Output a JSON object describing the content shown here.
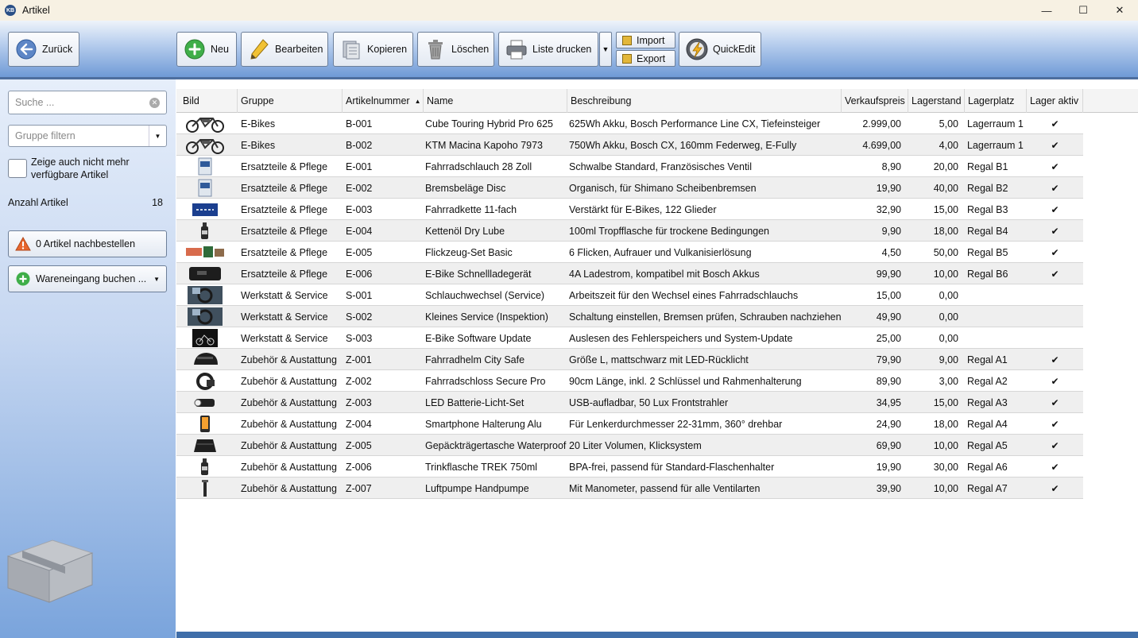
{
  "window": {
    "title": "Artikel",
    "app_icon": "KB",
    "controls": [
      "—",
      "☐",
      "✕"
    ]
  },
  "toolbar": {
    "back_label": "Zurück",
    "new_label": "Neu",
    "edit_label": "Bearbeiten",
    "copy_label": "Kopieren",
    "delete_label": "Löschen",
    "print_label": "Liste drucken",
    "import_label": "Import",
    "export_label": "Export",
    "quickedit_label": "QuickEdit"
  },
  "sidebar": {
    "search_placeholder": "Suche ...",
    "group_filter_placeholder": "Gruppe filtern",
    "show_unavailable_label": "Zeige auch nicht mehr verfügbare Artikel",
    "count_label": "Anzahl Artikel",
    "count_value": "18",
    "reorder_label": "0 Artikel nachbestellen",
    "goods_in_label": "Wareneingang buchen ..."
  },
  "table": {
    "columns": [
      "Bild",
      "Gruppe",
      "Artikelnummer",
      "Name",
      "Beschreibung",
      "Verkaufspreis",
      "Lagerstand",
      "Lagerplatz",
      "Lager aktiv"
    ],
    "sorted_column": "Artikelnummer",
    "rows": [
      {
        "img": "ebike",
        "group": "E-Bikes",
        "nr": "B-001",
        "name": "Cube Touring Hybrid Pro 625",
        "desc": "625Wh Akku, Bosch Performance Line CX, Tiefeinsteiger",
        "price": "2.999,00",
        "stock": "5,00",
        "place": "Lagerraum 1",
        "active": "✔"
      },
      {
        "img": "ebike",
        "group": "E-Bikes",
        "nr": "B-002",
        "name": "KTM Macina Kapoho 7973",
        "desc": "750Wh Akku, Bosch CX, 160mm Federweg, E-Fully",
        "price": "4.699,00",
        "stock": "4,00",
        "place": "Lagerraum 1",
        "active": "✔"
      },
      {
        "img": "box",
        "group": "Ersatzteile & Pflege",
        "nr": "E-001",
        "name": "Fahrradschlauch 28 Zoll",
        "desc": "Schwalbe Standard, Französisches Ventil",
        "price": "8,90",
        "stock": "20,00",
        "place": "Regal B1",
        "active": "✔"
      },
      {
        "img": "box",
        "group": "Ersatzteile & Pflege",
        "nr": "E-002",
        "name": "Bremsbeläge Disc",
        "desc": "Organisch, für Shimano Scheibenbremsen",
        "price": "19,90",
        "stock": "40,00",
        "place": "Regal B2",
        "active": "✔"
      },
      {
        "img": "chain",
        "group": "Ersatzteile & Pflege",
        "nr": "E-003",
        "name": "Fahrradkette 11-fach",
        "desc": "Verstärkt für E-Bikes, 122 Glieder",
        "price": "32,90",
        "stock": "15,00",
        "place": "Regal B3",
        "active": "✔"
      },
      {
        "img": "bottle",
        "group": "Ersatzteile & Pflege",
        "nr": "E-004",
        "name": "Kettenöl Dry Lube",
        "desc": "100ml Tropfflasche für trockene Bedingungen",
        "price": "9,90",
        "stock": "18,00",
        "place": "Regal B4",
        "active": "✔"
      },
      {
        "img": "kit",
        "group": "Ersatzteile & Pflege",
        "nr": "E-005",
        "name": "Flickzeug-Set Basic",
        "desc": "6 Flicken, Aufrauer und Vulkanisierlösung",
        "price": "4,50",
        "stock": "50,00",
        "place": "Regal B5",
        "active": "✔"
      },
      {
        "img": "charger",
        "group": "Ersatzteile & Pflege",
        "nr": "E-006",
        "name": "E-Bike Schnellladegerät",
        "desc": "4A Ladestrom, kompatibel mit Bosch Akkus",
        "price": "99,90",
        "stock": "10,00",
        "place": "Regal B6",
        "active": "✔"
      },
      {
        "img": "photo",
        "group": "Werkstatt & Service",
        "nr": "S-001",
        "name": "Schlauchwechsel (Service)",
        "desc": "Arbeitszeit für den Wechsel eines Fahrradschlauchs",
        "price": "15,00",
        "stock": "0,00",
        "place": "",
        "active": ""
      },
      {
        "img": "photo",
        "group": "Werkstatt & Service",
        "nr": "S-002",
        "name": "Kleines Service (Inspektion)",
        "desc": "Schaltung einstellen, Bremsen prüfen, Schrauben nachziehen",
        "price": "49,90",
        "stock": "0,00",
        "place": "",
        "active": ""
      },
      {
        "img": "dark",
        "group": "Werkstatt & Service",
        "nr": "S-003",
        "name": "E-Bike Software Update",
        "desc": "Auslesen des Fehlerspeichers und System-Update",
        "price": "25,00",
        "stock": "0,00",
        "place": "",
        "active": ""
      },
      {
        "img": "helmet",
        "group": "Zubehör & Austattung",
        "nr": "Z-001",
        "name": "Fahrradhelm City Safe",
        "desc": "Größe L, mattschwarz mit LED-Rücklicht",
        "price": "79,90",
        "stock": "9,00",
        "place": "Regal A1",
        "active": "✔"
      },
      {
        "img": "lock",
        "group": "Zubehör & Austattung",
        "nr": "Z-002",
        "name": "Fahrradschloss Secure Pro",
        "desc": "90cm Länge, inkl. 2 Schlüssel und Rahmenhalterung",
        "price": "89,90",
        "stock": "3,00",
        "place": "Regal A2",
        "active": "✔"
      },
      {
        "img": "light",
        "group": "Zubehör & Austattung",
        "nr": "Z-003",
        "name": "LED Batterie-Licht-Set",
        "desc": "USB-aufladbar, 50 Lux Frontstrahler",
        "price": "34,95",
        "stock": "15,00",
        "place": "Regal A3",
        "active": "✔"
      },
      {
        "img": "phone",
        "group": "Zubehör & Austattung",
        "nr": "Z-004",
        "name": "Smartphone Halterung Alu",
        "desc": "Für Lenkerdurchmesser 22-31mm, 360° drehbar",
        "price": "24,90",
        "stock": "18,00",
        "place": "Regal A4",
        "active": "✔"
      },
      {
        "img": "bag",
        "group": "Zubehör & Austattung",
        "nr": "Z-005",
        "name": "Gepäckträgertasche Waterproof",
        "desc": "20 Liter Volumen, Klicksystem",
        "price": "69,90",
        "stock": "10,00",
        "place": "Regal A5",
        "active": "✔"
      },
      {
        "img": "bottle",
        "group": "Zubehör & Austattung",
        "nr": "Z-006",
        "name": "Trinkflasche TREK 750ml",
        "desc": "BPA-frei, passend für Standard-Flaschenhalter",
        "price": "19,90",
        "stock": "30,00",
        "place": "Regal A6",
        "active": "✔"
      },
      {
        "img": "pump",
        "group": "Zubehör & Austattung",
        "nr": "Z-007",
        "name": "Luftpumpe Handpumpe",
        "desc": "Mit Manometer, passend für alle Ventilarten",
        "price": "39,90",
        "stock": "10,00",
        "place": "Regal A7",
        "active": "✔"
      }
    ]
  }
}
